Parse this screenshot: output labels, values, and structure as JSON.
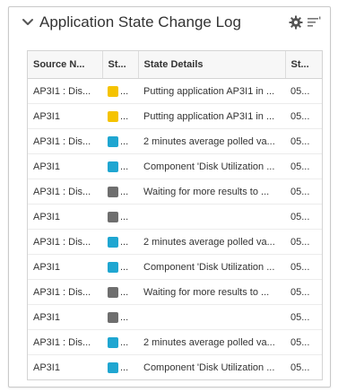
{
  "panel": {
    "title": "Application State Change Log",
    "collapse_icon": "chevron-down-icon",
    "settings_icon": "gear-icon",
    "menu_icon": "menu-lines-icon"
  },
  "colors": {
    "yellow": "#f5c300",
    "blue": "#1fa6d1",
    "gray": "#6e6e6e"
  },
  "table": {
    "headers": [
      "Source N...",
      "St...",
      "State Details",
      "St..."
    ],
    "rows": [
      {
        "source": "AP3I1 : Dis...",
        "state_color": "#f5c300",
        "state": "...",
        "details": "Putting application AP3I1 in ...",
        "time": "05..."
      },
      {
        "source": "AP3I1",
        "state_color": "#f5c300",
        "state": "...",
        "details": "Putting application AP3I1 in ...",
        "time": "05..."
      },
      {
        "source": "AP3I1 : Dis...",
        "state_color": "#1fa6d1",
        "state": "...",
        "details": "2 minutes average polled va...",
        "time": "05..."
      },
      {
        "source": "AP3I1",
        "state_color": "#1fa6d1",
        "state": "...",
        "details": "Component 'Disk Utilization ...",
        "time": "05..."
      },
      {
        "source": "AP3I1 : Dis...",
        "state_color": "#6e6e6e",
        "state": "...",
        "details": "Waiting for more results to ...",
        "time": "05..."
      },
      {
        "source": "AP3I1",
        "state_color": "#6e6e6e",
        "state": "...",
        "details": "",
        "time": "05..."
      },
      {
        "source": "AP3I1 : Dis...",
        "state_color": "#1fa6d1",
        "state": "...",
        "details": "2 minutes average polled va...",
        "time": "05..."
      },
      {
        "source": "AP3I1",
        "state_color": "#1fa6d1",
        "state": "...",
        "details": "Component 'Disk Utilization ...",
        "time": "05..."
      },
      {
        "source": "AP3I1 : Dis...",
        "state_color": "#6e6e6e",
        "state": "...",
        "details": "Waiting for more results to ...",
        "time": "05..."
      },
      {
        "source": "AP3I1",
        "state_color": "#6e6e6e",
        "state": "...",
        "details": "",
        "time": "05..."
      },
      {
        "source": "AP3I1 : Dis...",
        "state_color": "#1fa6d1",
        "state": "...",
        "details": "2 minutes average polled va...",
        "time": "05..."
      },
      {
        "source": "AP3I1",
        "state_color": "#1fa6d1",
        "state": "...",
        "details": "Component 'Disk Utilization ...",
        "time": "05..."
      }
    ]
  }
}
